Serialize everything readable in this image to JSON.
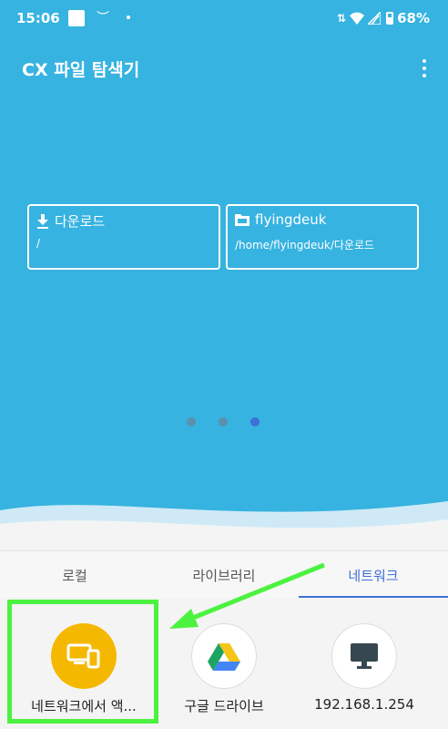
{
  "status_bar": {
    "time": "15:06",
    "battery": "68%"
  },
  "app": {
    "title": "CX 파일 탐색기"
  },
  "shortcuts": [
    {
      "name": "다운로드",
      "path": "/"
    },
    {
      "name": "flyingdeuk",
      "path": "/home/flyingdeuk/다운로드"
    }
  ],
  "tabs": [
    {
      "label": "로컬",
      "active": false
    },
    {
      "label": "라이브러리",
      "active": false
    },
    {
      "label": "네트워크",
      "active": true
    }
  ],
  "network_items": [
    {
      "label": "네트워크에서 액...",
      "icon": "devices-icon"
    },
    {
      "label": "구글 드라이브",
      "icon": "google-drive-icon"
    },
    {
      "label": "192.168.1.254",
      "icon": "monitor-icon"
    }
  ],
  "colors": {
    "header_bg": "#36b3e0",
    "accent": "#3f6fd8",
    "highlight": "#4cf240",
    "network_access_circle": "#f5b800"
  }
}
